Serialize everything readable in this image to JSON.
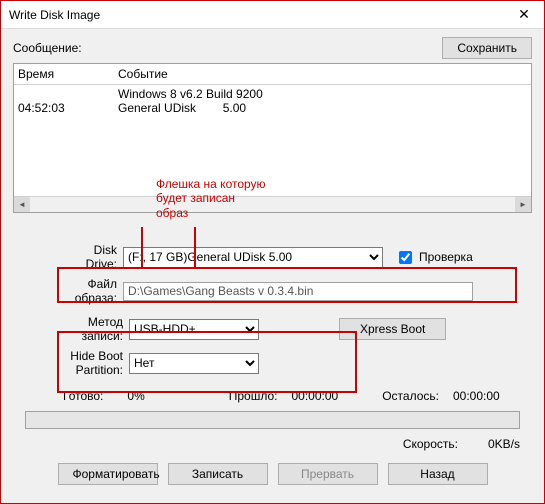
{
  "window": {
    "title": "Write Disk Image"
  },
  "labels": {
    "message": "Сообщение:",
    "save": "Сохранить",
    "time_col": "Время",
    "event_col": "Событие",
    "disk_drive": "Disk Drive:",
    "check": "Проверка",
    "file": "Файл образа:",
    "method": "Метод записи:",
    "hide": "Hide Boot Partition:",
    "xpress": "Xpress Boot",
    "ready": "Готово:",
    "elapsed": "Прошло:",
    "remaining": "Осталось:",
    "speed": "Скорость:",
    "format": "Форматировать",
    "write": "Записать",
    "abort": "Прервать",
    "back": "Назад"
  },
  "log": {
    "rows": [
      {
        "time": "",
        "event": "Windows 8 v6.2 Build 9200"
      },
      {
        "time": "04:52:03",
        "event": "General UDisk        5.00"
      }
    ]
  },
  "annotation": "Флешка на которую будет записан образ",
  "disk": {
    "selected": "(F:, 17 GB)General UDisk        5.00",
    "checked": true
  },
  "file_path": "D:\\Games\\Gang Beasts v 0.3.4.bin",
  "method": {
    "selected": "USB-HDD+"
  },
  "hide_boot": {
    "selected": "Нет"
  },
  "progress": {
    "ready_pct": "0%",
    "elapsed_time": "00:00:00",
    "remaining_time": "00:00:00",
    "speed_value": "0KB/s"
  }
}
